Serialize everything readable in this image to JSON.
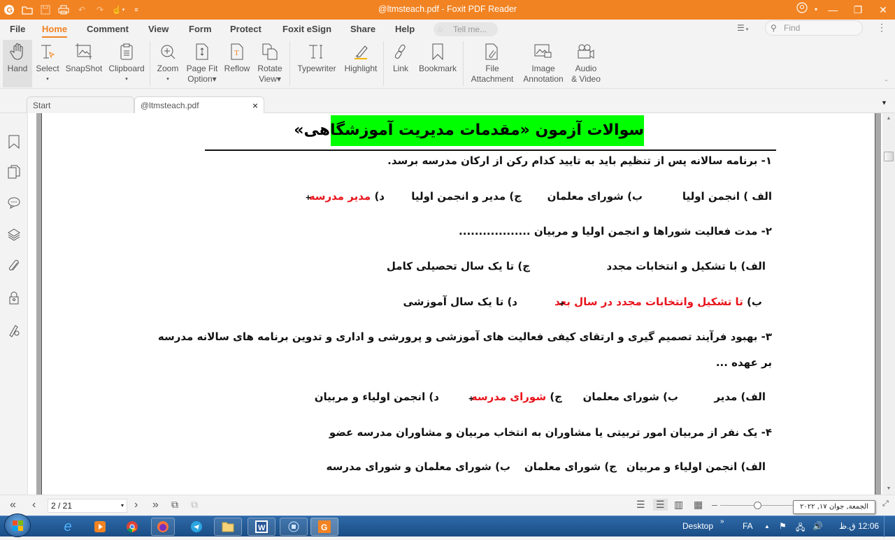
{
  "titlebar": {
    "title": "@ltmsteach.pdf - Foxit PDF Reader",
    "quick_access": [
      "foxit-logo-icon",
      "open-folder-icon",
      "save-icon",
      "print-icon",
      "undo-icon",
      "redo-icon",
      "hand-tool-icon",
      "customize-icon"
    ]
  },
  "menubar": {
    "items": [
      "File",
      "Home",
      "Comment",
      "View",
      "Form",
      "Protect",
      "Foxit eSign",
      "Share",
      "Help"
    ],
    "active": "Home",
    "tellme_placeholder": "Tell me...",
    "find_placeholder": "Find"
  },
  "ribbon": {
    "tools": [
      {
        "label": "Hand",
        "label2": ""
      },
      {
        "label": "Select",
        "label2": "▾"
      },
      {
        "label": "SnapShot",
        "label2": ""
      },
      {
        "label": "Clipboard",
        "label2": "▾"
      },
      {
        "label": "Zoom",
        "label2": "▾"
      },
      {
        "label": "Page Fit",
        "label2": "Option▾"
      },
      {
        "label": "Reflow",
        "label2": ""
      },
      {
        "label": "Rotate",
        "label2": "View▾"
      },
      {
        "label": "Typewriter",
        "label2": ""
      },
      {
        "label": "Highlight",
        "label2": ""
      },
      {
        "label": "Link",
        "label2": ""
      },
      {
        "label": "Bookmark",
        "label2": ""
      },
      {
        "label": "File",
        "label2": "Attachment"
      },
      {
        "label": "Image",
        "label2": "Annotation"
      },
      {
        "label": "Audio",
        "label2": "& Video"
      }
    ]
  },
  "tabs": [
    {
      "label": "Start"
    },
    {
      "label": "@ltmsteach.pdf",
      "close": "×"
    }
  ],
  "document": {
    "heading": "سوالات آزمون «مقدمات مدیریت آموزشگاهی»",
    "q1": {
      "text": "۱- برنامه سالانه پس از تنظیم باید به تایید کدام رکن از ارکان مدرسه برسد.",
      "a": "الف ) انجمن اولیا",
      "b": "ب) شورای معلمان",
      "c": "ج) مدیر و انجمن اولیا",
      "d_prefix": "د)",
      "d": "مدیر مدرسه",
      "answer": "d"
    },
    "q2": {
      "text": "۲- مدت فعالیت شوراها و انجمن اولیا و مربیان ..................",
      "a": "الف) با تشکیل و انتخابات مجدد",
      "c": "ج) تا یک سال تحصیلی کامل",
      "b_prefix": "ب)",
      "b": "تا تشکیل وانتخابات مجدد در سال بعد",
      "d": "د) تا یک سال آموزشی",
      "answer": "b"
    },
    "q3": {
      "text": "۳- بهبود فرآیند تصمیم گیری و ارتقای کیفی فعالیت های آموزشی و پرورشی و اداری و تدوین برنامه های سالانه مدرسه",
      "text2": "بر عهده ...",
      "a": "الف) مدیر",
      "b": "ب) شورای معلمان",
      "c_prefix": "ج)",
      "c": "شورای مدرسه",
      "d": "د) انجمن اولیاء و مربیان",
      "answer": "c"
    },
    "q4": {
      "text": "۴-  یک نفر از مربیان امور تربیتی یا مشاوران به انتخاب مربیان و مشاوران مدرسه عضو",
      "a": "الف) انجمن اولیاء و مربیان",
      "c": "ج) شورای معلمان",
      "b": "ب) شورای معلمان و شورای مدرسه"
    },
    "answer_marker": "+"
  },
  "statusbar": {
    "page_indicator": "2 / 21",
    "zoom_slider_fraction": 0.45,
    "tooltip": "الجمعة, جوان ١٧, ٢٠٢٢"
  },
  "taskbar": {
    "apps": [
      "internet-explorer",
      "media-player",
      "chrome",
      "firefox",
      "telegram",
      "file-explorer",
      "word",
      "screen-recorder",
      "foxit-reader"
    ],
    "desktop_label": "Desktop",
    "language": "FA",
    "clock": "12:06 ق.ظ"
  },
  "colors": {
    "accent": "#f28322",
    "answer": "#e8131b",
    "heading_bg": "#00ff00"
  }
}
